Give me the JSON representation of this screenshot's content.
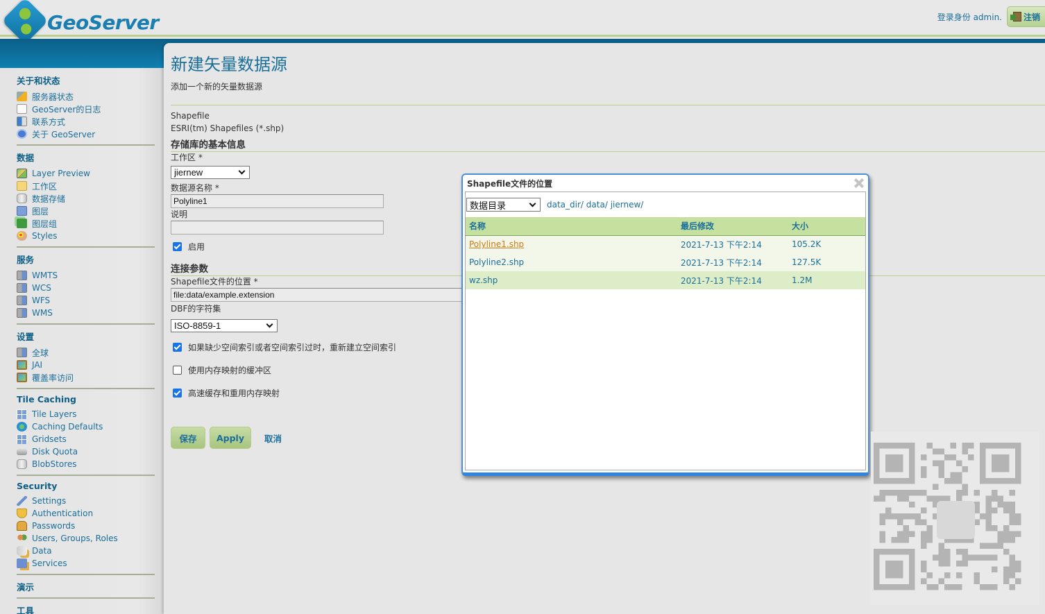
{
  "header": {
    "app_name": "GeoServer",
    "login_text": "登录身份 admin.",
    "logout_label": "注销"
  },
  "sidebar": {
    "sections": [
      {
        "title": "关于和状态",
        "items": [
          {
            "label": "服务器状态",
            "icon": "server-status-icon"
          },
          {
            "label": "GeoServer的日志",
            "icon": "log-icon"
          },
          {
            "label": "联系方式",
            "icon": "contact-icon"
          },
          {
            "label": "关于 GeoServer",
            "icon": "help-icon"
          }
        ]
      },
      {
        "title": "数据",
        "items": [
          {
            "label": "Layer Preview",
            "icon": "map-icon"
          },
          {
            "label": "工作区",
            "icon": "folder-icon"
          },
          {
            "label": "数据存储",
            "icon": "database-icon"
          },
          {
            "label": "图层",
            "icon": "layer-icon"
          },
          {
            "label": "图层组",
            "icon": "layer-group-icon"
          },
          {
            "label": "Styles",
            "icon": "palette-icon"
          }
        ]
      },
      {
        "title": "服务",
        "items": [
          {
            "label": "WMTS",
            "icon": "server-icon"
          },
          {
            "label": "WCS",
            "icon": "server-icon"
          },
          {
            "label": "WFS",
            "icon": "server-icon"
          },
          {
            "label": "WMS",
            "icon": "server-icon"
          }
        ]
      },
      {
        "title": "设置",
        "items": [
          {
            "label": "全球",
            "icon": "server-icon"
          },
          {
            "label": "JAI",
            "icon": "picture-icon"
          },
          {
            "label": "覆盖率访问",
            "icon": "picture-icon"
          }
        ]
      },
      {
        "title": "Tile Caching",
        "items": [
          {
            "label": "Tile Layers",
            "icon": "grid-icon"
          },
          {
            "label": "Caching Defaults",
            "icon": "globe-icon"
          },
          {
            "label": "Gridsets",
            "icon": "grid-icon"
          },
          {
            "label": "Disk Quota",
            "icon": "disk-icon"
          },
          {
            "label": "BlobStores",
            "icon": "database-icon"
          }
        ]
      },
      {
        "title": "Security",
        "items": [
          {
            "label": "Settings",
            "icon": "wrench-icon"
          },
          {
            "label": "Authentication",
            "icon": "shield-icon"
          },
          {
            "label": "Passwords",
            "icon": "lock-icon"
          },
          {
            "label": "Users, Groups, Roles",
            "icon": "users-icon"
          },
          {
            "label": "Data",
            "icon": "database-key-icon"
          },
          {
            "label": "Services",
            "icon": "service-key-icon"
          }
        ]
      },
      {
        "title": "演示",
        "items": []
      },
      {
        "title": "工具",
        "items": []
      }
    ]
  },
  "main": {
    "title": "新建矢量数据源",
    "description": "添加一个新的矢量数据源",
    "store_type": "Shapefile",
    "store_type_desc": "ESRI(tm) Shapefiles (*.shp)",
    "basic_info_heading": "存储库的基本信息",
    "workspace_label": "工作区 *",
    "workspace_value": "jiernew",
    "datasource_name_label": "数据源名称 *",
    "datasource_name_value": "Polyline1",
    "description_label": "说明",
    "description_value": "",
    "enabled_label": "启用",
    "enabled": true,
    "connection_heading": "连接参数",
    "shapefile_location_label": "Shapefile文件的位置 *",
    "shapefile_location_value": "file:data/example.extension",
    "dbf_charset_label": "DBF的字符集",
    "dbf_charset_value": "ISO-8859-1",
    "options": [
      {
        "label": "如果缺少空间索引或者空间索引过时，重新建立空间索引",
        "checked": true
      },
      {
        "label": "使用内存映射的缓冲区",
        "checked": false
      },
      {
        "label": "高速缓存和重用内存映射",
        "checked": true
      }
    ],
    "save_label": "保存",
    "apply_label": "Apply",
    "cancel_label": "取消"
  },
  "dialog": {
    "title": "Shapefile文件的位置",
    "root_select": "数据目录",
    "breadcrumb": [
      "data_dir/",
      "data/",
      "jiernew/"
    ],
    "columns": [
      "名称",
      "最后修改",
      "大小"
    ],
    "files": [
      {
        "name": "Polyline1.shp",
        "modified": "2021-7-13 下午2:14",
        "size": "105.2K",
        "hover": true
      },
      {
        "name": "Polyline2.shp",
        "modified": "2021-7-13 下午2:14",
        "size": "127.5K",
        "hover": false
      },
      {
        "name": "wz.shp",
        "modified": "2021-7-13 下午2:14",
        "size": "1.2M",
        "hover": false
      }
    ]
  },
  "colors": {
    "brand_blue": "#1a6e9a",
    "band_blue": "#0f7fb0",
    "accent_green": "#b9d08f",
    "table_header": "#c6e09f",
    "hover_link": "#d07a10"
  }
}
